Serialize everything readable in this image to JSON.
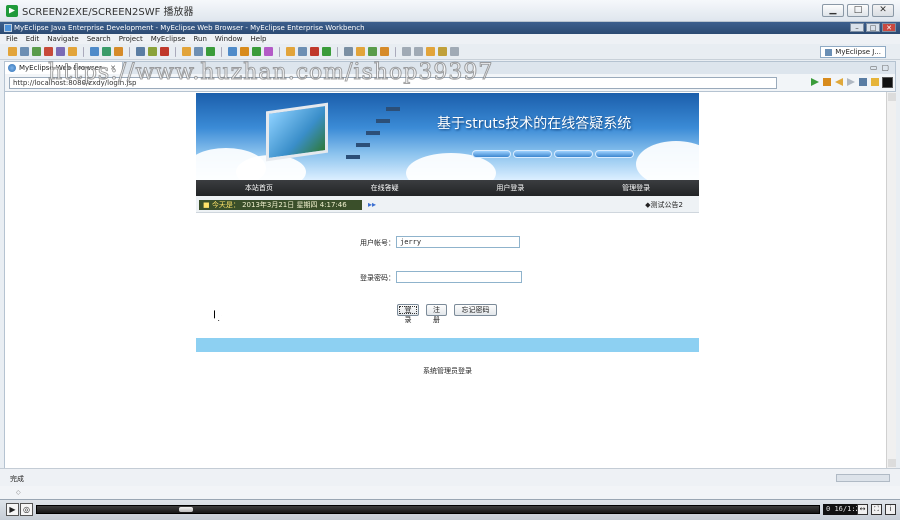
{
  "player": {
    "title": "SCREEN2EXE/SCREEN2SWF 播放器",
    "time": "0 16/1:27",
    "min": "▁",
    "restore": "□",
    "close": "✕"
  },
  "ide": {
    "title": "MyEclipse Java Enterprise Development - MyEclipse Web Browser - MyEclipse Enterprise Workbench",
    "menu": [
      "File",
      "Edit",
      "Navigate",
      "Search",
      "Project",
      "MyEclipse",
      "Run",
      "Window",
      "Help"
    ],
    "perspective": "MyEclipse J...",
    "tab_label": "MyEclipse Web Browser",
    "tab_close": "✕",
    "url": "http://localhost:8080/zxdy/login.jsp",
    "status": "完成"
  },
  "site": {
    "banner_title": "基于struts技术的在线答疑系统",
    "nav": [
      "本站首页",
      "在线答疑",
      "用户登录",
      "管理登录"
    ],
    "date_label": "■ 今天是：",
    "date_value": "2013年3月21日 星期四 4:17:46",
    "date_arrow": "▸▸",
    "notice": "◆测试公告2"
  },
  "login": {
    "username_label": "用户帐号：",
    "username_value": "jerry",
    "password_label": "登录密码：",
    "password_value": "",
    "login_button": "登录",
    "register_button": "注册",
    "forgot_button": "忘记密码"
  },
  "footer": {
    "admin_link": "系统管理员登录"
  },
  "watermark": "https://www.huzhan.com/ishop39397",
  "colors": {
    "nav_bg": "#2a2c2e",
    "info_bar": "#8dd0f2",
    "banner_blue": "#2a74c4"
  }
}
